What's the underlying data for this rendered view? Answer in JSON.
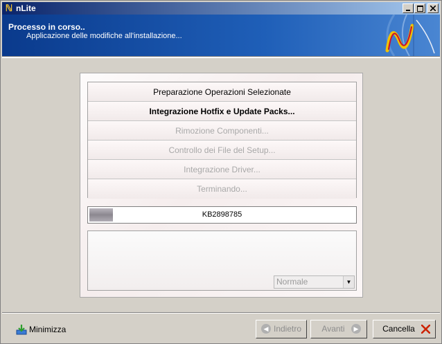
{
  "window": {
    "title": "nLite",
    "icon": "nlite-logo-icon"
  },
  "header": {
    "title": "Processo in corso..",
    "subtitle": "Applicazione delle modifiche all'installazione..."
  },
  "steps": [
    {
      "label": "Preparazione Operazioni Selezionate",
      "state": "done"
    },
    {
      "label": "Integrazione Hotfix e Update Packs...",
      "state": "active"
    },
    {
      "label": "Rimozione Componenti...",
      "state": "pending"
    },
    {
      "label": "Controllo dei File del Setup...",
      "state": "pending"
    },
    {
      "label": "Integrazione Driver...",
      "state": "pending"
    },
    {
      "label": "Terminando...",
      "state": "pending"
    }
  ],
  "progress": {
    "text": "KB2898785",
    "fraction": 0.09
  },
  "log": {
    "priority_select": "Normale"
  },
  "footer": {
    "minimize_label": "Minimizza",
    "back_label": "Indietro",
    "next_label": "Avanti",
    "cancel_label": "Cancella"
  },
  "colors": {
    "header_blue": "#1f5fb8",
    "cancel_red": "#cc2200"
  }
}
